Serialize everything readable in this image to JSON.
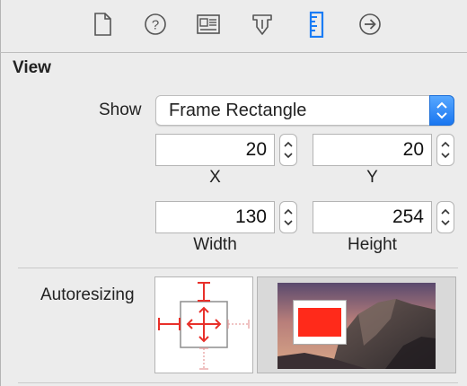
{
  "toolbar": {
    "icons": [
      "file-icon",
      "help-icon",
      "identity-icon",
      "attributes-icon",
      "size-ruler-icon",
      "connections-arrow-icon"
    ],
    "selected": "size-ruler-icon",
    "accent": "#1a7cf5"
  },
  "section": {
    "title": "View"
  },
  "show": {
    "label": "Show",
    "value": "Frame Rectangle"
  },
  "frame": {
    "x": {
      "value": "20",
      "label": "X"
    },
    "y": {
      "value": "20",
      "label": "Y"
    },
    "width": {
      "value": "130",
      "label": "Width"
    },
    "height": {
      "value": "254",
      "label": "Height"
    }
  },
  "autoresizing": {
    "label": "Autoresizing",
    "strut_color": "#e8302a",
    "preview_fill": "#ff2a1a"
  }
}
